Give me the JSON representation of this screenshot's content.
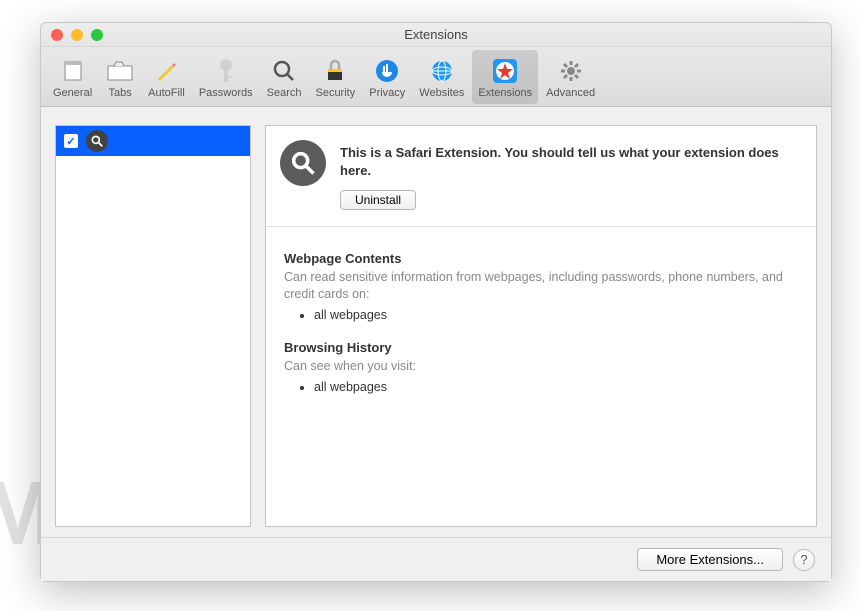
{
  "window": {
    "title": "Extensions"
  },
  "toolbar": {
    "items": [
      {
        "label": "General"
      },
      {
        "label": "Tabs"
      },
      {
        "label": "AutoFill"
      },
      {
        "label": "Passwords"
      },
      {
        "label": "Search"
      },
      {
        "label": "Security"
      },
      {
        "label": "Privacy"
      },
      {
        "label": "Websites"
      },
      {
        "label": "Extensions"
      },
      {
        "label": "Advanced"
      }
    ],
    "selected": "Extensions"
  },
  "sidebar": {
    "items": [
      {
        "name": "",
        "checked": true
      }
    ]
  },
  "detail": {
    "description": "This is a Safari Extension. You should tell us what your extension does here.",
    "uninstall_label": "Uninstall",
    "sections": [
      {
        "title": "Webpage Contents",
        "desc": "Can read sensitive information from webpages, including passwords, phone numbers, and credit cards on:",
        "bullets": [
          "all webpages"
        ]
      },
      {
        "title": "Browsing History",
        "desc": "Can see when you visit:",
        "bullets": [
          "all webpages"
        ]
      }
    ]
  },
  "footer": {
    "more_label": "More Extensions...",
    "help_label": "?"
  },
  "watermark": "MALWARETIPS"
}
